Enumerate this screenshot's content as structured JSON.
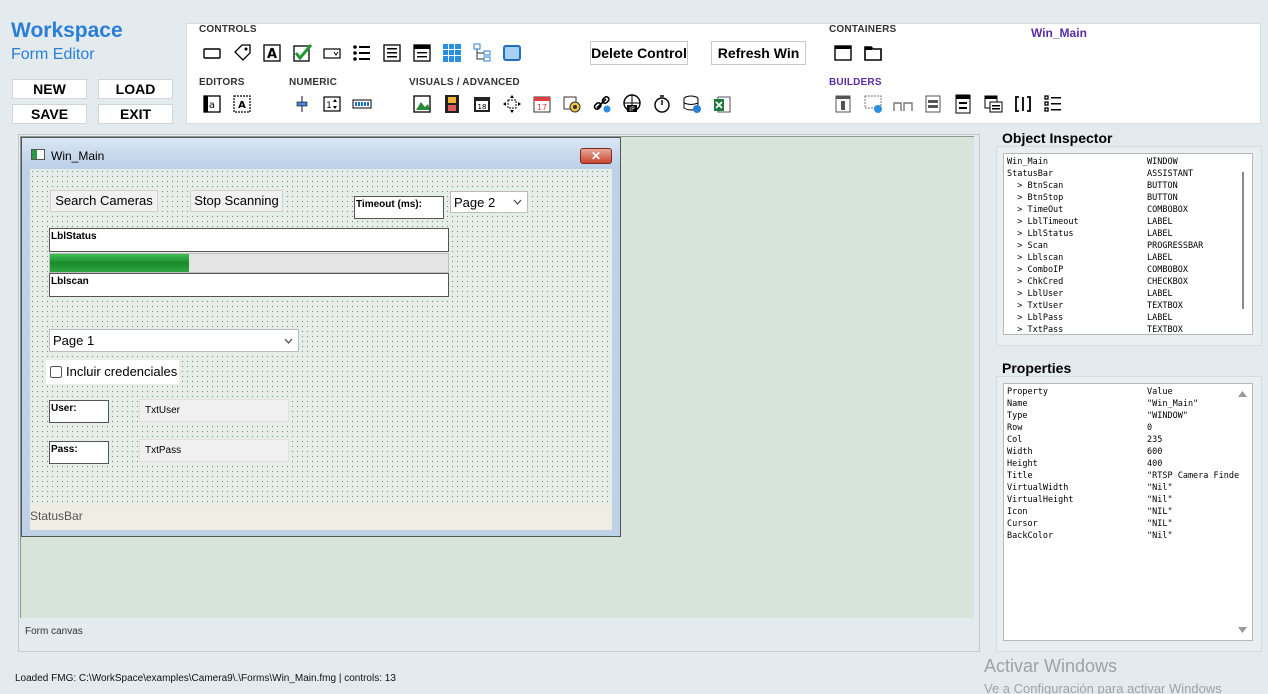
{
  "app": {
    "title": "Workspace",
    "subtitle": "Form Editor"
  },
  "menu": {
    "new": "NEW",
    "load": "LOAD",
    "save": "SAVE",
    "exit": "EXIT"
  },
  "toolbar": {
    "controls_label": "CONTROLS",
    "editors_label": "EDITORS",
    "numeric_label": "NUMERIC",
    "visuals_label": "VISUALS / ADVANCED",
    "containers_label": "CONTAINERS",
    "builders_label": "BUILDERS",
    "delete_label": "Delete Control",
    "refresh_label": "Refresh Win",
    "active_window": "Win_Main"
  },
  "canvas": {
    "caption": "Form canvas"
  },
  "form": {
    "title": "Win_Main",
    "btn_search": "Search Cameras",
    "btn_stop": "Stop Scanning",
    "lbl_timeout": "Timeout (ms):",
    "combo_timeout": "Page 2",
    "lbl_status": "LblStatus",
    "progress": 0.35,
    "lbl_scan": "Lblscan",
    "combo_ip": "Page 1",
    "chk_cred": "Incluir credenciales",
    "lbl_user": "User:",
    "txt_user": "TxtUser",
    "lbl_pass": "Pass:",
    "txt_pass": "TxtPass",
    "statusbar": "StatusBar"
  },
  "inspector": {
    "title": "Object Inspector",
    "items": [
      {
        "name": "Win_Main",
        "type": "WINDOW"
      },
      {
        "name": "StatusBar",
        "type": "ASSISTANT"
      },
      {
        "name": "  > BtnScan",
        "type": "BUTTON"
      },
      {
        "name": "  > BtnStop",
        "type": "BUTTON"
      },
      {
        "name": "  > TimeOut",
        "type": "COMBOBOX"
      },
      {
        "name": "  > LblTimeout",
        "type": "LABEL"
      },
      {
        "name": "  > LblStatus",
        "type": "LABEL"
      },
      {
        "name": "  > Scan",
        "type": "PROGRESSBAR"
      },
      {
        "name": "  > Lblscan",
        "type": "LABEL"
      },
      {
        "name": "  > ComboIP",
        "type": "COMBOBOX"
      },
      {
        "name": "  > ChkCred",
        "type": "CHECKBOX"
      },
      {
        "name": "  > LblUser",
        "type": "LABEL"
      },
      {
        "name": "  > TxtUser",
        "type": "TEXTBOX"
      },
      {
        "name": "  > LblPass",
        "type": "LABEL"
      },
      {
        "name": "  > TxtPass",
        "type": "TEXTBOX"
      }
    ]
  },
  "properties": {
    "title": "Properties",
    "header": {
      "name": "Property",
      "value": "Value"
    },
    "items": [
      {
        "name": "Name",
        "value": "\"Win_Main\""
      },
      {
        "name": "Type",
        "value": "\"WINDOW\""
      },
      {
        "name": "Row",
        "value": "0"
      },
      {
        "name": "Col",
        "value": "235"
      },
      {
        "name": "Width",
        "value": "600"
      },
      {
        "name": "Height",
        "value": "400"
      },
      {
        "name": "Title",
        "value": "\"RTSP Camera Finde"
      },
      {
        "name": "VirtualWidth",
        "value": "\"Nil\""
      },
      {
        "name": "VirtualHeight",
        "value": "\"Nil\""
      },
      {
        "name": "Icon",
        "value": "\"NIL\""
      },
      {
        "name": "Cursor",
        "value": "\"NIL\""
      },
      {
        "name": "BackColor",
        "value": "\"Nil\""
      }
    ]
  },
  "status": {
    "text": "Loaded FMG: C:\\WorkSpace\\examples\\Camera9\\.\\Forms\\Win_Main.fmg | controls: 13"
  },
  "watermark": {
    "line1": "Activar Windows",
    "line2": "Ve a Configuración para activar Windows"
  },
  "colors": {
    "brand": "#2a7ed6",
    "accent": "#5a2da8",
    "progress": "#1f9a2f"
  }
}
